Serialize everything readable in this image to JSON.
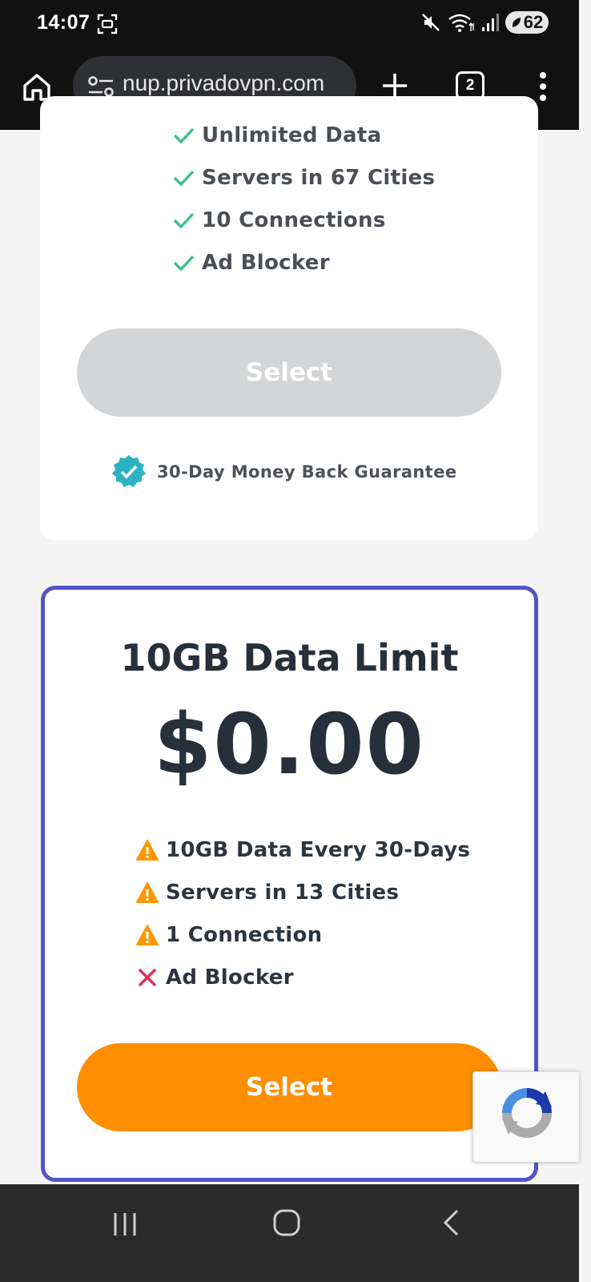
{
  "status_bar": {
    "time": "14:07",
    "battery": "62",
    "icons": [
      "screenshot-icon",
      "mute-icon",
      "wifi-icon",
      "signal-icon"
    ]
  },
  "browser": {
    "url": "nup.privadovpn.com",
    "tab_count": "2",
    "icons": [
      "home-icon",
      "site-settings-icon",
      "new-tab-icon",
      "tab-switcher-icon",
      "overflow-menu-icon"
    ]
  },
  "plan_top": {
    "features": [
      {
        "label": "Unlimited Data",
        "status": "check"
      },
      {
        "label": "Servers in 67 Cities",
        "status": "check"
      },
      {
        "label": "10 Connections",
        "status": "check"
      },
      {
        "label": "Ad Blocker",
        "status": "check"
      }
    ],
    "select_label": "Select",
    "guarantee": "30-Day Money Back Guarantee"
  },
  "plan_free": {
    "title": "10GB Data Limit",
    "price": "$0.00",
    "features": [
      {
        "label": "10GB Data Every 30-Days",
        "status": "warning"
      },
      {
        "label": "Servers in 13 Cities",
        "status": "warning"
      },
      {
        "label": "1 Connection",
        "status": "warning"
      },
      {
        "label": "Ad Blocker",
        "status": "cross"
      }
    ],
    "select_label": "Select"
  },
  "colors": {
    "check": "#3dbf8a",
    "warning": "#ff9800",
    "cross": "#e0315b",
    "highlight_border": "#4f54c7",
    "cta_orange": "#ff8f00",
    "cta_disabled": "#d4d5d7",
    "guarantee_badge": "#2bb3c4"
  }
}
